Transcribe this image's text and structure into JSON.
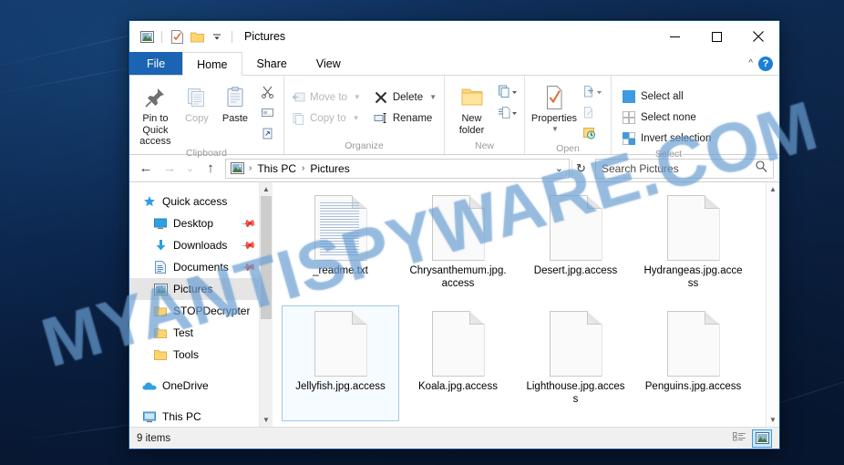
{
  "desktop": {
    "background_color": "#0b2545",
    "watermark_text": "MYANTISPYWARE.COM"
  },
  "window": {
    "title": "Pictures",
    "quick_access_toolbar": [
      {
        "name": "pictures-library-icon",
        "label": "Pictures library"
      },
      {
        "name": "properties-icon",
        "label": "Properties"
      },
      {
        "name": "new-folder-icon",
        "label": "New folder"
      },
      {
        "name": "customize-qat-icon",
        "label": "Customize Quick Access Toolbar"
      }
    ],
    "caption": {
      "minimize": "─",
      "maximize": "☐",
      "close": "✕"
    }
  },
  "tabs": {
    "file": "File",
    "items": [
      {
        "label": "Home",
        "active": true
      },
      {
        "label": "Share",
        "active": false
      },
      {
        "label": "View",
        "active": false
      }
    ],
    "collapse_ribbon": "^",
    "help": "?"
  },
  "ribbon": {
    "groups": [
      {
        "name": "clipboard",
        "label": "Clipboard",
        "big_buttons": [
          {
            "name": "pin-to-quick-access",
            "label": "Pin to Quick\naccess",
            "line1": "Pin to Quick",
            "line2": "access",
            "disabled": false
          },
          {
            "name": "copy",
            "label": "Copy",
            "disabled": true
          },
          {
            "name": "paste",
            "label": "Paste",
            "disabled": false
          }
        ],
        "mini_buttons": [
          {
            "name": "cut",
            "label": "Cut"
          },
          {
            "name": "copy-path",
            "label": "Copy path"
          },
          {
            "name": "paste-shortcut",
            "label": "Paste shortcut"
          }
        ]
      },
      {
        "name": "organize",
        "label": "Organize",
        "small_buttons": [
          {
            "name": "move-to",
            "label": "Move to",
            "has_caret": true,
            "disabled": true
          },
          {
            "name": "copy-to",
            "label": "Copy to",
            "has_caret": true,
            "disabled": true
          },
          {
            "name": "delete",
            "label": "Delete",
            "has_caret": true,
            "disabled": false
          },
          {
            "name": "rename",
            "label": "Rename",
            "has_caret": false,
            "disabled": false
          }
        ]
      },
      {
        "name": "new",
        "label": "New",
        "big_buttons": [
          {
            "name": "new-folder",
            "line1": "New",
            "line2": "folder",
            "label": "New folder"
          }
        ],
        "mini_buttons": [
          {
            "name": "new-item",
            "label": "New item"
          },
          {
            "name": "easy-access",
            "label": "Easy access"
          }
        ]
      },
      {
        "name": "open",
        "label": "Open",
        "big_buttons": [
          {
            "name": "properties",
            "label": "Properties",
            "has_caret": true
          }
        ],
        "mini_buttons": [
          {
            "name": "open-with",
            "label": "Open"
          },
          {
            "name": "edit",
            "label": "Edit"
          },
          {
            "name": "history",
            "label": "History"
          }
        ]
      },
      {
        "name": "select",
        "label": "Select",
        "small_buttons": [
          {
            "name": "select-all",
            "label": "Select all"
          },
          {
            "name": "select-none",
            "label": "Select none"
          },
          {
            "name": "invert-selection",
            "label": "Invert selection"
          }
        ]
      }
    ]
  },
  "address_bar": {
    "back": "←",
    "forward": "→",
    "recent": "⌄",
    "up": "↑",
    "breadcrumbs": [
      {
        "label": "This PC"
      },
      {
        "label": "Pictures"
      }
    ],
    "dropdown": "⌄",
    "refresh": "↻",
    "search_placeholder": "Search Pictures",
    "search_value": ""
  },
  "nav_pane": {
    "items": [
      {
        "name": "quick-access",
        "label": "Quick access",
        "icon": "star-icon",
        "indent": false,
        "pinned": false,
        "selected": false
      },
      {
        "name": "desktop",
        "label": "Desktop",
        "icon": "desktop-icon",
        "indent": true,
        "pinned": true,
        "selected": false
      },
      {
        "name": "downloads",
        "label": "Downloads",
        "icon": "download-icon",
        "indent": true,
        "pinned": true,
        "selected": false
      },
      {
        "name": "documents",
        "label": "Documents",
        "icon": "documents-icon",
        "indent": true,
        "pinned": true,
        "selected": false
      },
      {
        "name": "pictures",
        "label": "Pictures",
        "icon": "pictures-icon",
        "indent": true,
        "pinned": false,
        "selected": true
      },
      {
        "name": "stopdecrypter",
        "label": "STOPDecrypter",
        "icon": "folder-icon",
        "indent": true,
        "pinned": false,
        "selected": false
      },
      {
        "name": "test",
        "label": "Test",
        "icon": "folder-icon",
        "indent": true,
        "pinned": false,
        "selected": false
      },
      {
        "name": "tools",
        "label": "Tools",
        "icon": "folder-icon",
        "indent": true,
        "pinned": false,
        "selected": false
      },
      {
        "name": "onedrive",
        "label": "OneDrive",
        "icon": "cloud-icon",
        "indent": false,
        "pinned": false,
        "selected": false,
        "gap_before": true
      },
      {
        "name": "this-pc",
        "label": "This PC",
        "icon": "pc-icon",
        "indent": false,
        "pinned": false,
        "selected": false,
        "gap_before": true
      }
    ]
  },
  "files": [
    {
      "name": "_readme.txt",
      "type": "text",
      "selected": false
    },
    {
      "name": "Chrysanthemum.jpg.access",
      "type": "generic",
      "selected": false
    },
    {
      "name": "Desert.jpg.access",
      "type": "generic",
      "selected": false
    },
    {
      "name": "Hydrangeas.jpg.access",
      "type": "generic",
      "selected": false
    },
    {
      "name": "Jellyfish.jpg.access",
      "type": "generic",
      "selected": true
    },
    {
      "name": "Koala.jpg.access",
      "type": "generic",
      "selected": false
    },
    {
      "name": "Lighthouse.jpg.access",
      "type": "generic",
      "selected": false
    },
    {
      "name": "Penguins.jpg.access",
      "type": "generic",
      "selected": false
    }
  ],
  "status_bar": {
    "item_count": "9 items",
    "view_buttons": [
      {
        "name": "details-view",
        "label": "Details view",
        "active": false
      },
      {
        "name": "large-icons-view",
        "label": "Large icons view",
        "active": true
      }
    ]
  }
}
